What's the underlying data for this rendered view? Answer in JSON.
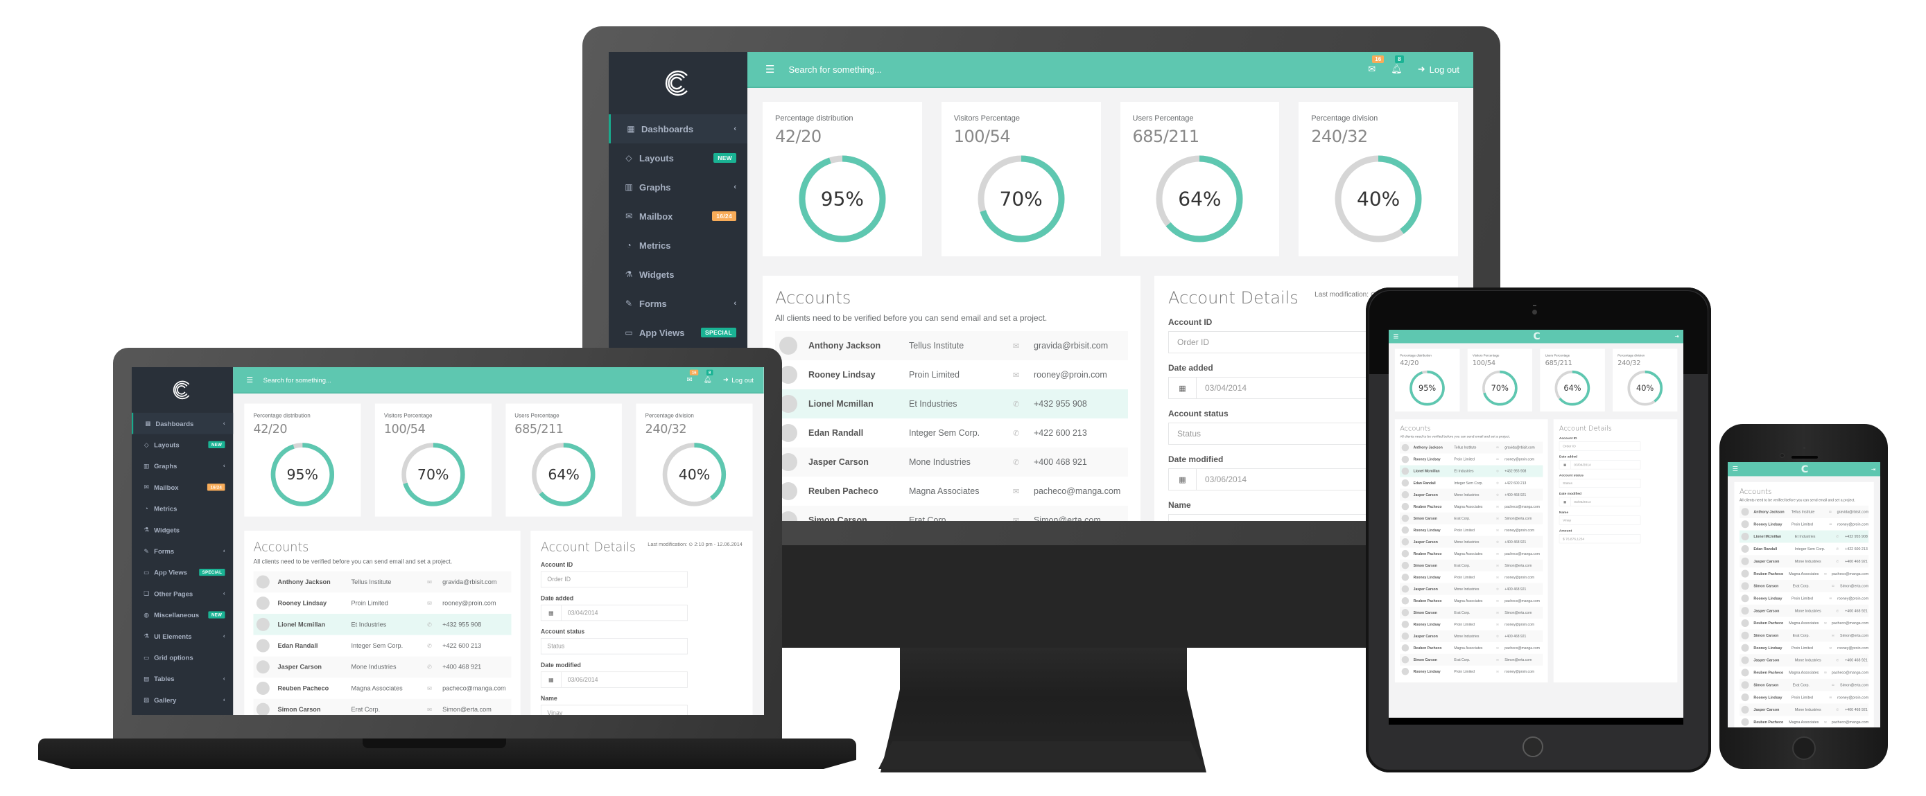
{
  "app": {
    "search_placeholder": "Search for something...",
    "logout_label": "Log out",
    "mail_count": "16",
    "notif_count": "8",
    "colors": {
      "accent": "#5ec7b0",
      "sidebar": "#293039",
      "teal_badge": "#1ab394",
      "orange_badge": "#f8ac59",
      "track": "#d6d6d6"
    },
    "sidebar": {
      "items": [
        {
          "label": "Dashboards",
          "icon": "th-large-icon",
          "glyph": "▦",
          "arrow": "‹",
          "badge": null,
          "active": true
        },
        {
          "label": "Layouts",
          "icon": "diamond-icon",
          "glyph": "◇",
          "arrow": "",
          "badge": "NEW",
          "badge_color": "teal"
        },
        {
          "label": "Graphs",
          "icon": "bar-chart-icon",
          "glyph": "▥",
          "arrow": "‹",
          "badge": null
        },
        {
          "label": "Mailbox",
          "icon": "envelope-icon",
          "glyph": "✉",
          "arrow": "",
          "badge": "16/24",
          "badge_color": "orange"
        },
        {
          "label": "Metrics",
          "icon": "pie-chart-icon",
          "glyph": "◔",
          "arrow": "",
          "badge": null
        },
        {
          "label": "Widgets",
          "icon": "flask-icon",
          "glyph": "⚗",
          "arrow": "",
          "badge": null
        },
        {
          "label": "Forms",
          "icon": "edit-icon",
          "glyph": "✎",
          "arrow": "‹",
          "badge": null
        },
        {
          "label": "App Views",
          "icon": "desktop-icon",
          "glyph": "▭",
          "arrow": "",
          "badge": "SPECIAL",
          "badge_color": "teal"
        },
        {
          "label": "Other Pages",
          "icon": "files-icon",
          "glyph": "❏",
          "arrow": "‹",
          "badge": null
        },
        {
          "label": "Miscellaneous",
          "icon": "globe-icon",
          "glyph": "◍",
          "arrow": "",
          "badge": "NEW",
          "badge_color": "teal"
        },
        {
          "label": "UI Elements",
          "icon": "flask-icon",
          "glyph": "⚗",
          "arrow": "‹",
          "badge": null
        },
        {
          "label": "Grid options",
          "icon": "laptop-icon",
          "glyph": "▭",
          "arrow": "",
          "badge": null
        },
        {
          "label": "Tables",
          "icon": "table-icon",
          "glyph": "▤",
          "arrow": "‹",
          "badge": null
        },
        {
          "label": "Gallery",
          "icon": "picture-icon",
          "glyph": "▨",
          "arrow": "‹",
          "badge": null
        }
      ]
    },
    "stats": [
      {
        "title": "Percentage distribution",
        "value": "42/20",
        "percent": 95,
        "label": "95%"
      },
      {
        "title": "Visitors Percentage",
        "value": "100/54",
        "percent": 70,
        "label": "70%"
      },
      {
        "title": "Users Percentage",
        "value": "685/211",
        "percent": 64,
        "label": "64%"
      },
      {
        "title": "Percentage division",
        "value": "240/32",
        "percent": 40,
        "label": "40%"
      }
    ],
    "accounts": {
      "title": "Accounts",
      "subtitle": "All clients need to be verified before you can send email and set a project.",
      "rows": [
        {
          "name": "Anthony Jackson",
          "company": "Tellus Institute",
          "contact_type": "email",
          "contact": "gravida@rbisit.com"
        },
        {
          "name": "Rooney Lindsay",
          "company": "Proin Limited",
          "contact_type": "email",
          "contact": "rooney@proin.com"
        },
        {
          "name": "Lionel Mcmillan",
          "company": "Et Industries",
          "contact_type": "phone",
          "contact": "+432 955 908",
          "selected": true
        },
        {
          "name": "Edan Randall",
          "company": "Integer Sem Corp.",
          "contact_type": "phone",
          "contact": "+422 600 213"
        },
        {
          "name": "Jasper Carson",
          "company": "Mone Industries",
          "contact_type": "phone",
          "contact": "+400 468 921"
        },
        {
          "name": "Reuben Pacheco",
          "company": "Magna Associates",
          "contact_type": "email",
          "contact": "pacheco@manga.com"
        },
        {
          "name": "Simon Carson",
          "company": "Erat Corp.",
          "contact_type": "email",
          "contact": "Simon@erta.com"
        },
        {
          "name": "Rooney Lindsay",
          "company": "Proin Limited",
          "contact_type": "email",
          "contact": "rooney@proin.com"
        },
        {
          "name": "Jasper Carson",
          "company": "Mone Industries",
          "contact_type": "phone",
          "contact": "+400 468 921"
        },
        {
          "name": "Reuben Pacheco",
          "company": "Magna Associates",
          "contact_type": "email",
          "contact": "pacheco@manga.com"
        },
        {
          "name": "Simon Carson",
          "company": "Erat Corp.",
          "contact_type": "email",
          "contact": "Simon@erta.com"
        },
        {
          "name": "Rooney Lindsay",
          "company": "Proin Limited",
          "contact_type": "email",
          "contact": "rooney@proin.com"
        },
        {
          "name": "Jasper Carson",
          "company": "Mone Industries",
          "contact_type": "phone",
          "contact": "+400 468 921"
        },
        {
          "name": "Reuben Pacheco",
          "company": "Magna Associates",
          "contact_type": "email",
          "contact": "pacheco@manga.com"
        },
        {
          "name": "Simon Carson",
          "company": "Erat Corp.",
          "contact_type": "email",
          "contact": "Simon@erta.com"
        },
        {
          "name": "Rooney Lindsay",
          "company": "Proin Limited",
          "contact_type": "email",
          "contact": "rooney@proin.com"
        },
        {
          "name": "Jasper Carson",
          "company": "Mone Industries",
          "contact_type": "phone",
          "contact": "+400 468 921"
        },
        {
          "name": "Reuben Pacheco",
          "company": "Magna Associates",
          "contact_type": "email",
          "contact": "pacheco@manga.com"
        },
        {
          "name": "Simon Carson",
          "company": "Erat Corp.",
          "contact_type": "email",
          "contact": "Simon@erta.com"
        },
        {
          "name": "Rooney Lindsay",
          "company": "Proin Limited",
          "contact_type": "email",
          "contact": "rooney@proin.com"
        }
      ]
    },
    "details": {
      "title": "Account Details",
      "last_modification": "Last modification: ⊙ 2:10 pm - 12.06.2014",
      "fields": [
        {
          "label": "Account ID",
          "value": "Order ID",
          "addon": null
        },
        {
          "label": "Date added",
          "value": "03/04/2014",
          "addon": "calendar"
        },
        {
          "label": "Account status",
          "value": "Status",
          "addon": null
        },
        {
          "label": "Date modified",
          "value": "03/06/2014",
          "addon": "calendar"
        },
        {
          "label": "Name",
          "value": "Vinay",
          "addon": null
        },
        {
          "label": "Amount",
          "value": "$ 76,876,1234",
          "addon": null
        }
      ]
    }
  }
}
